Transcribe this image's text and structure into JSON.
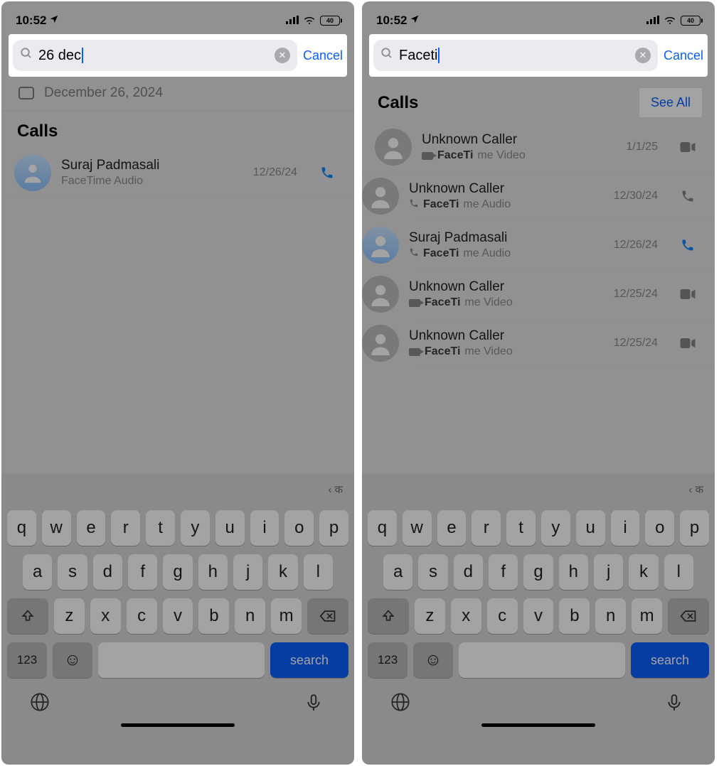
{
  "status": {
    "time": "10:52",
    "battery": "40"
  },
  "cancel_label": "Cancel",
  "left": {
    "search_value": "26 dec",
    "date_label": "December 26, 2024",
    "calls_title": "Calls",
    "call": {
      "name": "Suraj Padmasali",
      "sub": "FaceTime Audio",
      "date": "12/26/24"
    }
  },
  "right": {
    "search_value": "Faceti",
    "calls_title": "Calls",
    "see_all": "See All",
    "calls": [
      {
        "name": "Unknown Caller",
        "subA": "FaceTi",
        "subB": "me Video",
        "date": "1/1/25",
        "type": "video",
        "avatar": "placeholder"
      },
      {
        "name": "Unknown Caller",
        "subA": "FaceTi",
        "subB": "me Audio",
        "date": "12/30/24",
        "type": "phone-grey",
        "avatar": "placeholder"
      },
      {
        "name": "Suraj Padmasali",
        "subA": "FaceTi",
        "subB": "me Audio",
        "date": "12/26/24",
        "type": "phone-blue",
        "avatar": "photo"
      },
      {
        "name": "Unknown Caller",
        "subA": "FaceTi",
        "subB": "me Video",
        "date": "12/25/24",
        "type": "video",
        "avatar": "placeholder"
      },
      {
        "name": "Unknown Caller",
        "subA": "FaceTi",
        "subB": "me Video",
        "date": "12/25/24",
        "type": "video",
        "avatar": "placeholder"
      }
    ]
  },
  "keyboard": {
    "hint": "‹ क",
    "row1": [
      "q",
      "w",
      "e",
      "r",
      "t",
      "y",
      "u",
      "i",
      "o",
      "p"
    ],
    "row2": [
      "a",
      "s",
      "d",
      "f",
      "g",
      "h",
      "j",
      "k",
      "l"
    ],
    "row3": [
      "z",
      "x",
      "c",
      "v",
      "b",
      "n",
      "m"
    ],
    "num": "123",
    "search": "search"
  }
}
